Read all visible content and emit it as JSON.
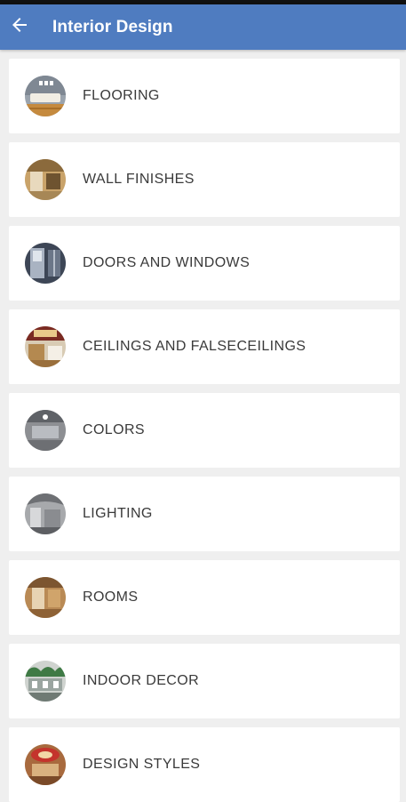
{
  "app_bar": {
    "title": "Interior Design",
    "back_icon": "arrow-left-icon",
    "color": "#4f7cc0"
  },
  "categories": [
    {
      "label": "FLOORING",
      "icon": "flooring-thumbnail"
    },
    {
      "label": "WALL FINISHES",
      "icon": "wall-finishes-thumbnail"
    },
    {
      "label": "DOORS AND WINDOWS",
      "icon": "doors-windows-thumbnail"
    },
    {
      "label": "CEILINGS AND FALSECEILINGS",
      "icon": "ceilings-thumbnail"
    },
    {
      "label": "COLORS",
      "icon": "colors-thumbnail"
    },
    {
      "label": "LIGHTING",
      "icon": "lighting-thumbnail"
    },
    {
      "label": "ROOMS",
      "icon": "rooms-thumbnail"
    },
    {
      "label": "INDOOR DECOR",
      "icon": "indoor-decor-thumbnail"
    },
    {
      "label": "DESIGN STYLES",
      "icon": "design-styles-thumbnail"
    }
  ]
}
